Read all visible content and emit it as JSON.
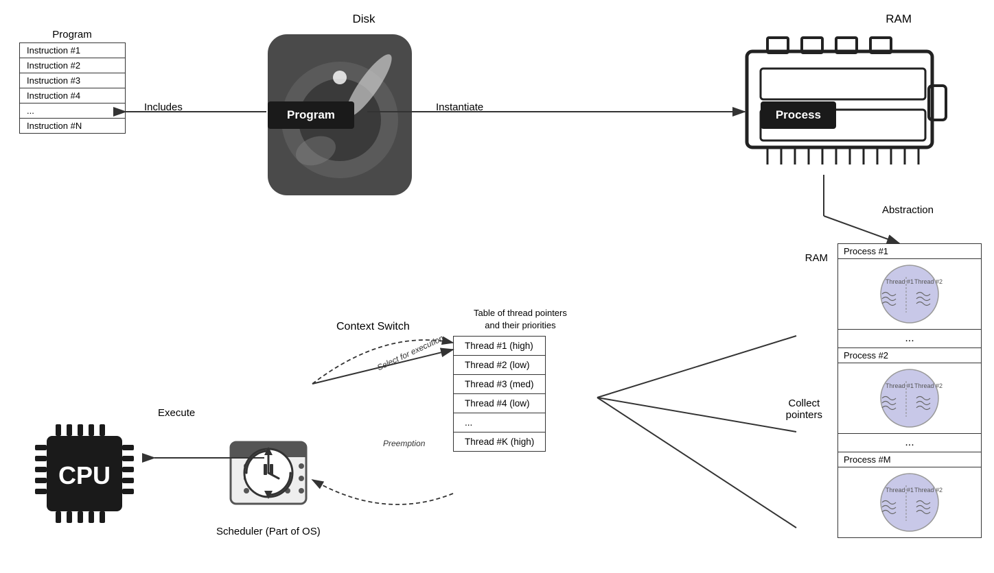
{
  "program": {
    "title": "Program",
    "instructions": [
      "Instruction #1",
      "Instruction #2",
      "Instruction #3",
      "Instruction #4",
      "...",
      "Instruction #N"
    ]
  },
  "disk": {
    "label": "Disk",
    "program_pill": "Program"
  },
  "ram_top": {
    "label": "RAM",
    "process_pill": "Process"
  },
  "arrows": {
    "includes_label": "Includes",
    "instantiate_label": "Instantiate",
    "abstraction_label": "Abstraction",
    "execute_label": "Execute",
    "context_switch_label": "Context Switch",
    "select_label": "Select for execution",
    "preemption_label": "Preemption",
    "collect_pointers_label": "Collect\npointers"
  },
  "thread_table": {
    "header": "Table of thread pointers\nand their priorities",
    "rows": [
      "Thread #1 (high)",
      "Thread #2 (low)",
      "Thread #3 (med)",
      "Thread #4 (low)",
      "...",
      "Thread #K (high)"
    ]
  },
  "cpu": {
    "label": "CPU"
  },
  "scheduler": {
    "label": "Scheduler\n(Part of OS)"
  },
  "ram_bottom": {
    "label": "RAM"
  },
  "processes": {
    "title1": "Process #1",
    "title2": "Process #2",
    "titleM": "Process #M",
    "ellipsis": "..."
  }
}
